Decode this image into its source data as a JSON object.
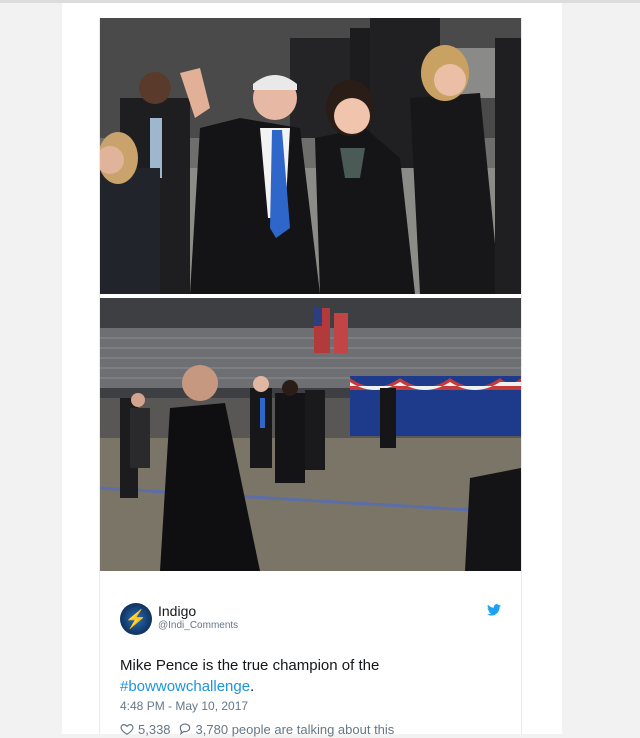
{
  "tweet": {
    "display_name": "Indigo",
    "handle": "@Indi_Comments",
    "text_before": "Mike Pence is the true champion of the ",
    "hashtag": "#bowwowchallenge",
    "text_after": ".",
    "timestamp": "4:48 PM - May 10, 2017",
    "likes": "5,338",
    "talking": "3,780 people are talking about this"
  },
  "colors": {
    "accent": "#1b95e0",
    "text": "#14171a",
    "muted": "#657786"
  },
  "icons": [
    "twitter-bird-icon",
    "heart-icon",
    "speech-bubble-icon"
  ]
}
